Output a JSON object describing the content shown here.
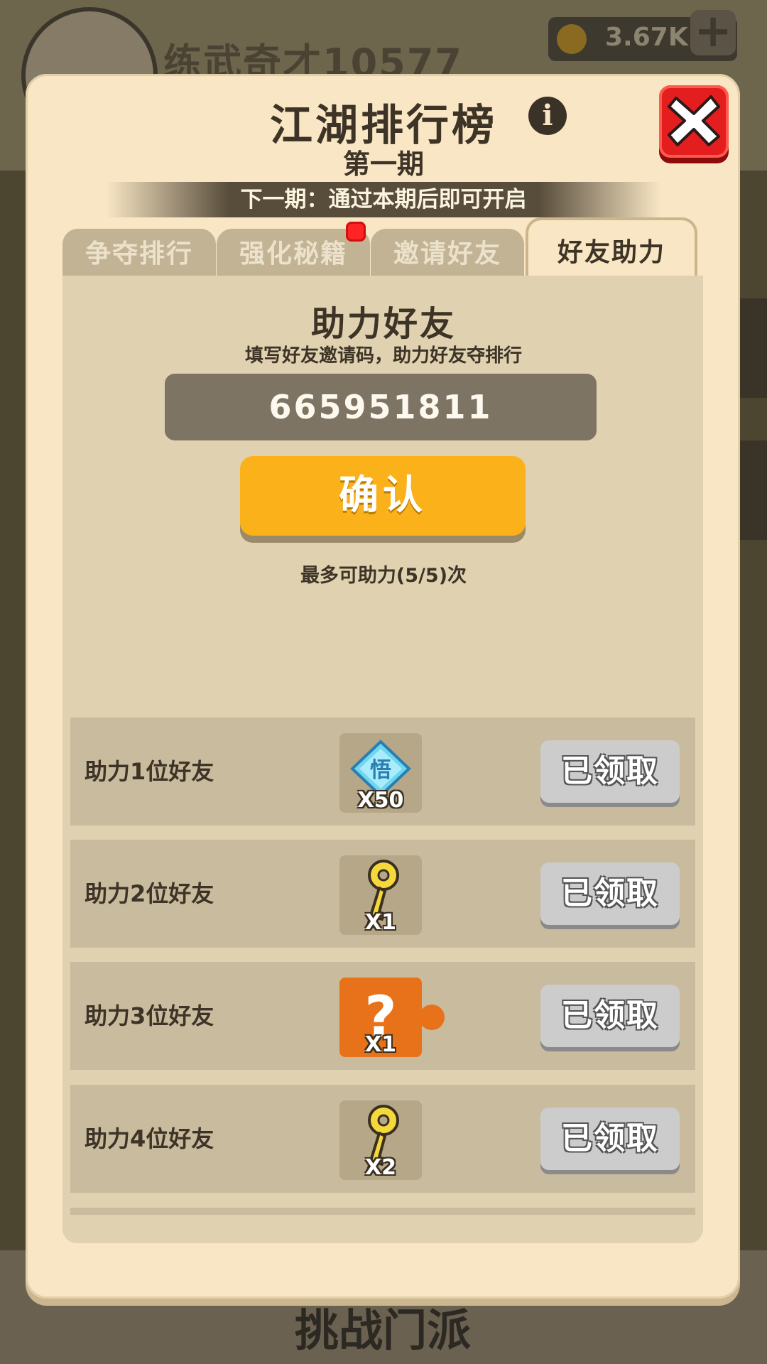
{
  "background": {
    "player_name": "练武奇才10577",
    "currency_value": "3.67K",
    "bottom_title": "挑战门派"
  },
  "modal": {
    "title": "江湖排行榜",
    "subtitle": "第一期",
    "banner": "下一期：通过本期后即可开启",
    "info_icon": "info-icon",
    "close_icon": "close-icon"
  },
  "tabs": [
    {
      "label": "争夺排行",
      "active": false
    },
    {
      "label": "强化秘籍",
      "active": false,
      "badge": true
    },
    {
      "label": "邀请好友",
      "active": false
    },
    {
      "label": "好友助力",
      "active": true
    }
  ],
  "assist": {
    "title": "助力好友",
    "description": "填写好友邀请码，助力好友夺排行",
    "code_value": "665951811",
    "confirm_label": "确认",
    "limit_text": "最多可助力(5/5)次"
  },
  "rewards": [
    {
      "label": "助力1位好友",
      "icon": "enlightenment-gem-icon",
      "count": "X50",
      "button": "已领取"
    },
    {
      "label": "助力2位好友",
      "icon": "gold-key-icon",
      "count": "X1",
      "button": "已领取"
    },
    {
      "label": "助力3位好友",
      "icon": "mystery-puzzle-icon",
      "count": "X1",
      "button": "已领取"
    },
    {
      "label": "助力4位好友",
      "icon": "gold-key-icon",
      "count": "X2",
      "button": "已领取"
    }
  ],
  "colors": {
    "modal_bg": "#f8e6c4",
    "accent_button": "#fbb21a",
    "close_red": "#e41e1e",
    "claimed_gray": "#cccccc"
  }
}
